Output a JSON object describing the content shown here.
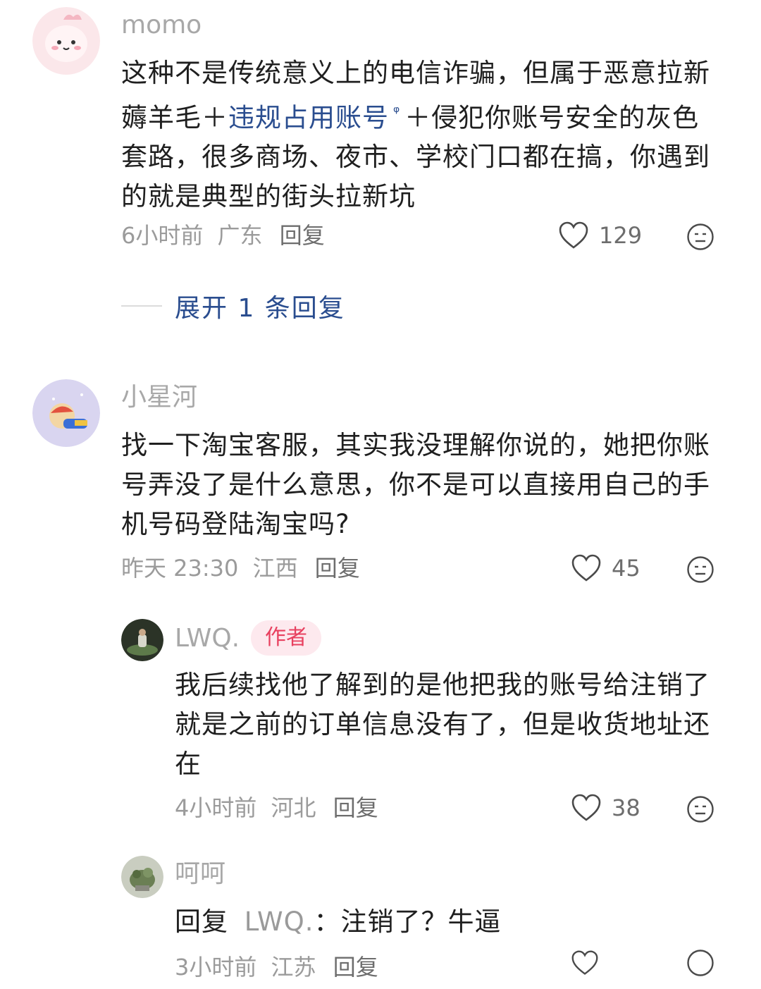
{
  "comments": [
    {
      "username": "momo",
      "body_parts": {
        "p1": "这种不是传统意义上的电信诈骗，但属于恶意拉新薅羊毛＋",
        "link": "违规占用账号",
        "p2": "＋侵犯你账号安全的灰色套路，很多商场、夜市、学校门口都在搞，你遇到的就是典型的街头拉新坑"
      },
      "time": "6小时前",
      "location": "广东",
      "reply_label": "回复",
      "likes": "129"
    },
    {
      "username": "小星河",
      "body": "找一下淘宝客服，其实我没理解你说的，她把你账号弄没了是什么意思，你不是可以直接用自己的手机号码登陆淘宝吗?",
      "time": "昨天 23:30",
      "location": "江西",
      "reply_label": "回复",
      "likes": "45"
    },
    {
      "username": "LWQ.",
      "badge": "作者",
      "body": "我后续找他了解到的是他把我的账号给注销了就是之前的订单信息没有了，但是收货地址还在",
      "time": "4小时前",
      "location": "河北",
      "reply_label": "回复",
      "likes": "38"
    },
    {
      "username": "呵呵",
      "reply_prefix": "回复",
      "reply_to": "LWQ.",
      "body": "：注销了？牛逼",
      "time": "3小时前",
      "location": "江苏",
      "reply_label": "回复"
    }
  ],
  "expand": {
    "label": "展开 1 条回复"
  },
  "colors": {
    "link": "#2a4d8f",
    "badge_bg": "#fde9ee",
    "badge_text": "#e8405f"
  }
}
